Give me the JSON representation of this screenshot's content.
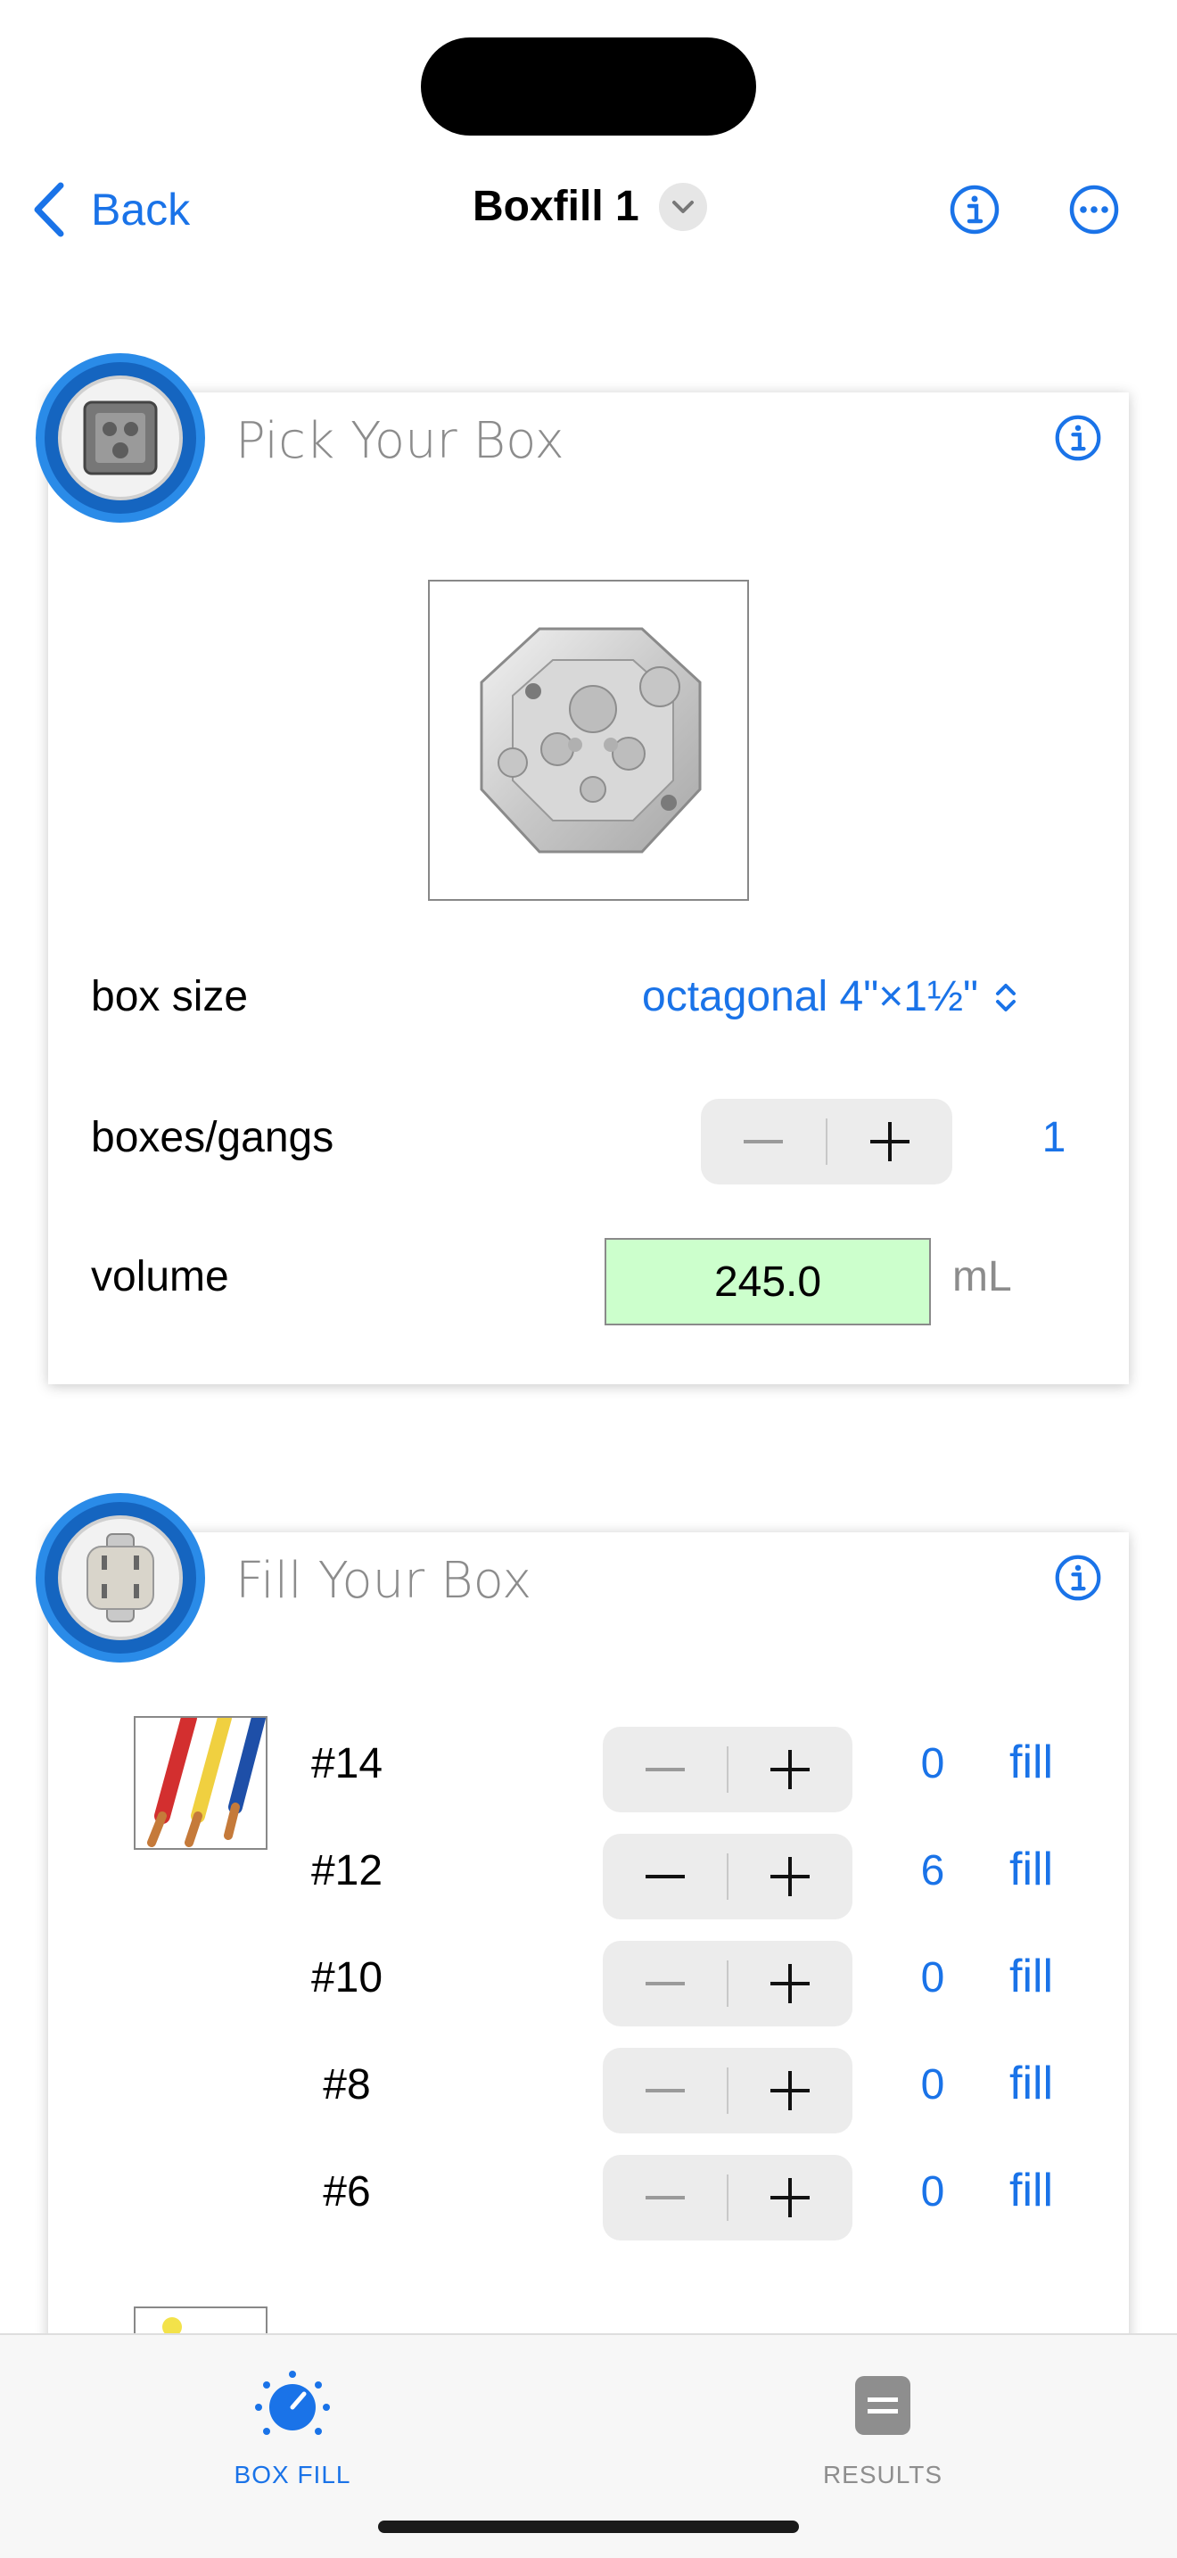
{
  "nav": {
    "back_label": "Back",
    "title": "Boxfill 1"
  },
  "pick_box": {
    "title": "Pick Your Box",
    "box_size_label": "box size",
    "box_size_value": "octagonal 4\"×1½\"",
    "boxes_label": "boxes/gangs",
    "boxes_count": "1",
    "volume_label": "volume",
    "volume_value": "245.0",
    "volume_unit": "mL"
  },
  "fill_box": {
    "title": "Fill Your Box",
    "wires": [
      {
        "gauge": "#14",
        "count": "0",
        "action": "fill"
      },
      {
        "gauge": "#12",
        "count": "6",
        "action": "fill"
      },
      {
        "gauge": "#10",
        "count": "0",
        "action": "fill"
      },
      {
        "gauge": "#8",
        "count": "0",
        "action": "fill"
      },
      {
        "gauge": "#6",
        "count": "0",
        "action": "fill"
      }
    ]
  },
  "tabs": [
    {
      "label": "BOX FILL",
      "icon": "gauge-icon",
      "active": true
    },
    {
      "label": "RESULTS",
      "icon": "equals-icon",
      "active": false
    }
  ],
  "colors": {
    "accent": "#1a73e8",
    "volume_bg": "#ccffcc",
    "badge": "#1565c0"
  }
}
